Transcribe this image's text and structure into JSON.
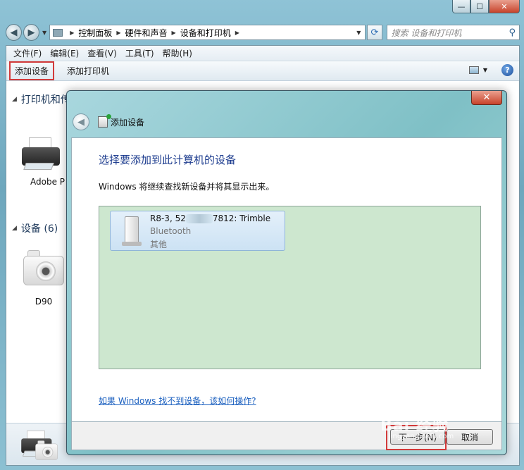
{
  "window": {
    "caption_buttons": {
      "minimize": "—",
      "maximize": "☐",
      "close": "✕"
    }
  },
  "navbar": {
    "back_glyph": "◀",
    "forward_glyph": "▶",
    "breadcrumbs": [
      "控制面板",
      "硬件和声音",
      "设备和打印机"
    ],
    "search_placeholder": "搜索 设备和打印机"
  },
  "menubar": {
    "items": [
      "文件(F)",
      "编辑(E)",
      "查看(V)",
      "工具(T)",
      "帮助(H)"
    ]
  },
  "cmdbar": {
    "add_device": "添加设备",
    "add_printer": "添加打印机"
  },
  "groups": {
    "printers_header": "打印机和传",
    "printer_item": "Adobe P",
    "devices_header": "设备 (6)",
    "device_item": "D90"
  },
  "dialog": {
    "close": "✕",
    "title": "添加设备",
    "heading": "选择要添加到此计算机的设备",
    "subtitle": "Windows 将继续查找新设备并将其显示出来。",
    "device": {
      "name_prefix": "R8-3, 52",
      "name_suffix": "7812: Trimble",
      "type": "Bluetooth",
      "category": "其他"
    },
    "help_link": "如果 Windows 找不到设备，该如何操作?",
    "next_button": "下一步(N)",
    "cancel_button": "取消"
  },
  "watermark": {
    "text": "Bai 经验",
    "url": "jingyan.baidu.com"
  }
}
